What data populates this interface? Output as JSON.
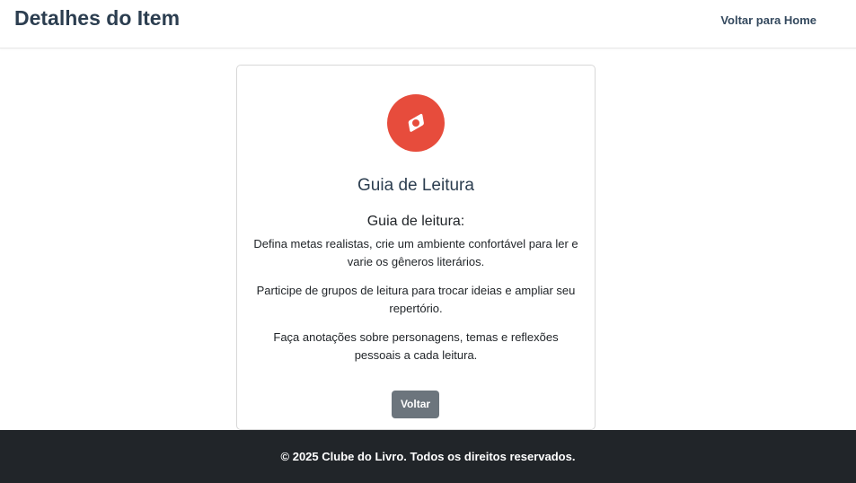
{
  "header": {
    "title": "Detalhes do Item",
    "home_link": "Voltar para Home"
  },
  "card": {
    "icon": "compass-icon",
    "title": "Guia de Leitura",
    "guide_heading": "Guia de leitura:",
    "tips": [
      "Defina metas realistas, crie um ambiente confortável para ler e varie os gêneros literários.",
      "Participe de grupos de leitura para trocar ideias e ampliar seu repertório.",
      "Faça anotações sobre personagens, temas e reflexões pessoais a cada leitura."
    ],
    "back_button": "Voltar"
  },
  "footer": {
    "copyright": "© 2025 Clube do Livro. Todos os direitos reservados."
  },
  "colors": {
    "icon_background": "#e74c3c",
    "footer_background": "#212529",
    "button_background": "#6c757d",
    "heading_text": "#2c3e50"
  }
}
